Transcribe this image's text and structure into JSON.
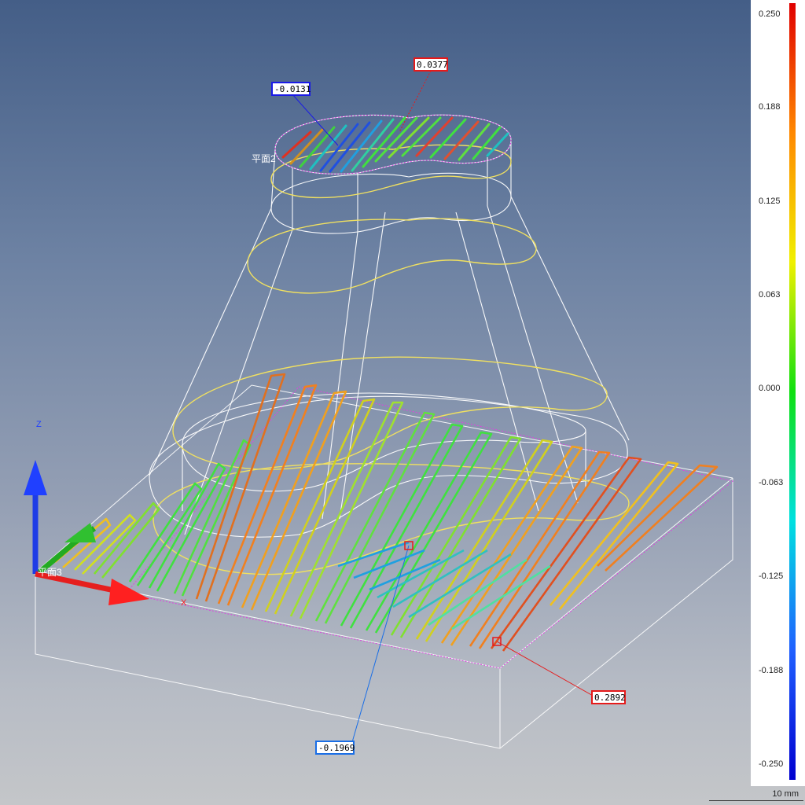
{
  "viewport": {
    "callouts": [
      {
        "name": "callout-top-min",
        "value": "-0.0131",
        "color": "#1a1ae6"
      },
      {
        "name": "callout-top-max",
        "value": "0.0377",
        "color": "#e61a1a"
      },
      {
        "name": "callout-bottom-max",
        "value": "0.2892",
        "color": "#e61a1a"
      },
      {
        "name": "callout-bottom-min",
        "value": "-0.1969",
        "color": "#1a6ee6"
      }
    ],
    "plane_labels": {
      "plane2": "平面2",
      "plane3": "平面3"
    },
    "axis_labels": {
      "z": "Z",
      "x": "X"
    },
    "colors": {
      "measure_plane": "#e040e0",
      "wire": "#ffffff",
      "contour": "#f0e060",
      "axis_x": "#e61e1e",
      "axis_y": "#22aa22",
      "axis_z": "#1e3ce6"
    }
  },
  "legend": {
    "ticks": [
      "0.250",
      "0.188",
      "0.125",
      "0.063",
      "0.000",
      "-0.063",
      "-0.125",
      "-0.188",
      "-0.250"
    ],
    "range": [
      -0.25,
      0.25
    ],
    "gradient": [
      "#e00000",
      "#ff8800",
      "#f0f000",
      "#10e010",
      "#00e0e0",
      "#2060ff",
      "#0000d0"
    ]
  },
  "scale_bar": {
    "label": "10 mm"
  }
}
